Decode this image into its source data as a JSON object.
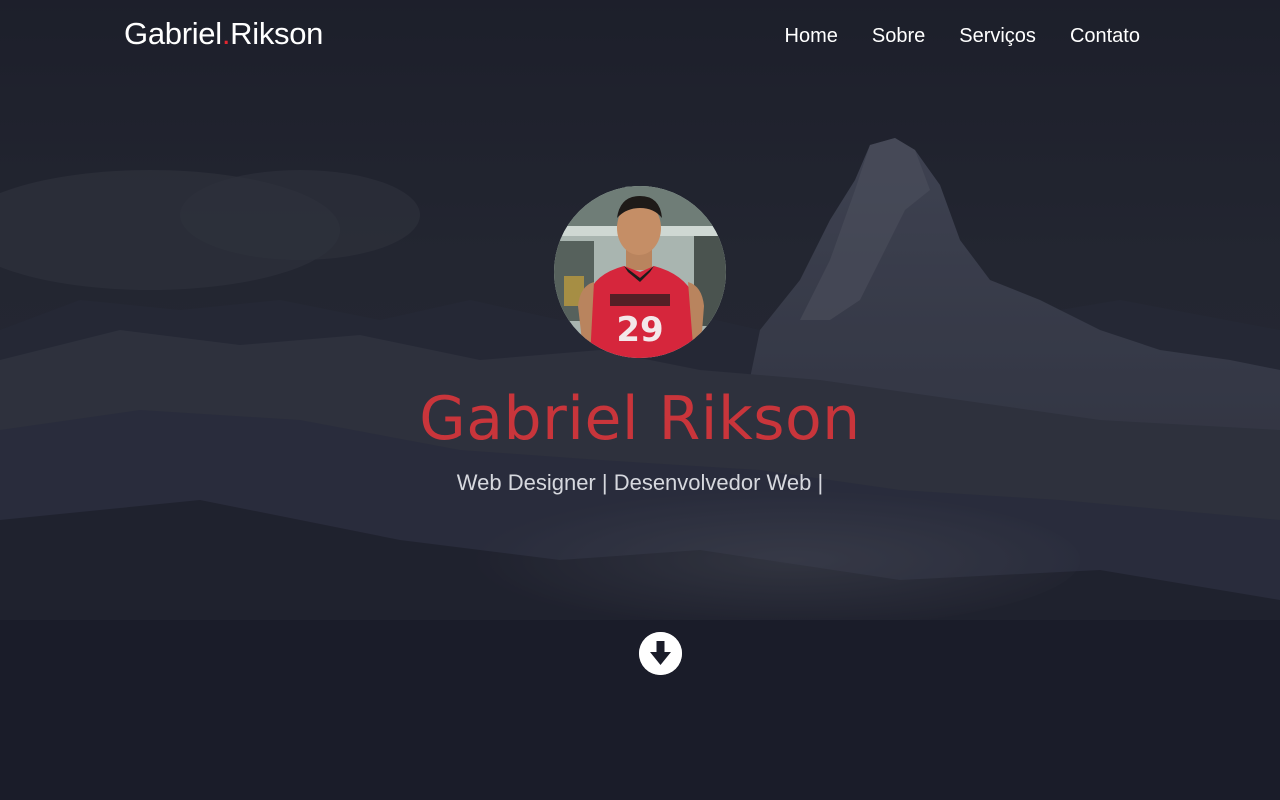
{
  "navbar": {
    "brand": {
      "first": "Gabriel",
      "dot": ".",
      "last": "Rikson"
    },
    "links": [
      {
        "label": "Home"
      },
      {
        "label": "Sobre"
      },
      {
        "label": "Serviços"
      },
      {
        "label": "Contato"
      }
    ]
  },
  "hero": {
    "name": "Gabriel Rikson",
    "subtitle": "Web Designer | Desenvolvedor Web |",
    "avatar_icon": "profile-photo",
    "background_icon": "mountain-landscape"
  },
  "scroll_down": {
    "icon": "arrow-down-circle-icon"
  },
  "colors": {
    "accent": "#c9353b",
    "brand_dot": "#e3262f",
    "page_background": "#1a1c29",
    "text": "#ffffff"
  }
}
